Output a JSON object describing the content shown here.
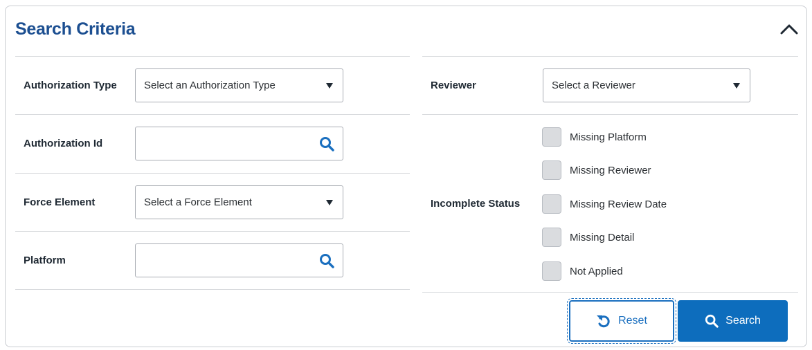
{
  "panel": {
    "title": "Search Criteria",
    "collapse_icon": "chevron-up-icon"
  },
  "fields": {
    "authorization_type": {
      "label": "Authorization Type",
      "value": "Select an Authorization Type"
    },
    "authorization_id": {
      "label": "Authorization Id",
      "value": ""
    },
    "force_element": {
      "label": "Force Element",
      "value": "Select a Force Element"
    },
    "platform": {
      "label": "Platform",
      "value": ""
    },
    "reviewer": {
      "label": "Reviewer",
      "value": "Select a Reviewer"
    },
    "incomplete_status": {
      "label": "Incomplete Status",
      "options": [
        {
          "label": "Missing Platform",
          "checked": false
        },
        {
          "label": "Missing Reviewer",
          "checked": false
        },
        {
          "label": "Missing Review Date",
          "checked": false
        },
        {
          "label": "Missing Detail",
          "checked": false
        },
        {
          "label": "Not Applied",
          "checked": false
        }
      ]
    }
  },
  "actions": {
    "reset_label": "Reset",
    "search_label": "Search"
  },
  "colors": {
    "title": "#1c4f91",
    "primary": "#0d6dbd",
    "search_icon": "#1a6fbf"
  }
}
